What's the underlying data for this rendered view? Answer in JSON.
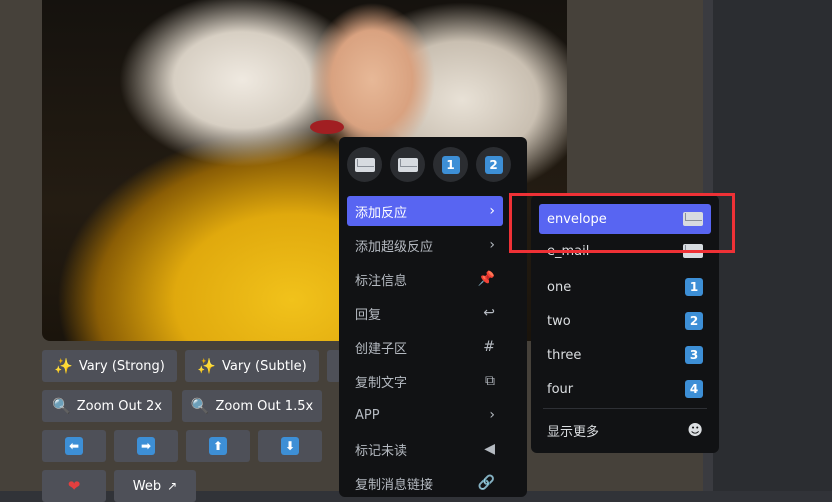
{
  "image_buttons": [
    {
      "label": "Vary (Strong)",
      "icon": "sparkles-icon"
    },
    {
      "label": "Vary (Subtle)",
      "icon": "sparkles-icon"
    },
    {
      "label": "Zoom Out 2x",
      "icon": "magnifier-icon"
    },
    {
      "label": "Zoom Out 1.5x",
      "icon": "magnifier-icon"
    },
    {
      "label": "",
      "icon": "arrow-left-icon"
    },
    {
      "label": "",
      "icon": "arrow-right-icon"
    },
    {
      "label": "",
      "icon": "arrow-up-icon"
    },
    {
      "label": "",
      "icon": "arrow-down-icon"
    },
    {
      "label": "",
      "icon": "heart-icon"
    },
    {
      "label": "Web",
      "icon": "external-link-icon"
    }
  ],
  "quick_reactions": [
    {
      "emoji": "envelope",
      "glyph": "✉"
    },
    {
      "emoji": "e_mail",
      "glyph": "✉"
    },
    {
      "emoji": "one",
      "glyph": "1"
    },
    {
      "emoji": "two",
      "glyph": "2"
    }
  ],
  "menu": {
    "items": [
      {
        "label": "添加反应",
        "right": "›"
      },
      {
        "label": "添加超级反应",
        "right": "›"
      },
      {
        "label": "标注信息",
        "right": "📌"
      },
      {
        "label": "回复",
        "right": "↩"
      },
      {
        "label": "创建子区",
        "right": "#"
      },
      {
        "label": "复制文字",
        "right": "⧉"
      },
      {
        "label": "APP",
        "right": "›"
      },
      {
        "label": "标记未读",
        "right": "◀"
      },
      {
        "label": "复制消息链接",
        "right": "🔗"
      }
    ]
  },
  "submenu": {
    "items": [
      {
        "name": "envelope",
        "glyph": "envelope"
      },
      {
        "name": "e_mail",
        "glyph": "envelope"
      },
      {
        "name": "one",
        "glyph": "1"
      },
      {
        "name": "two",
        "glyph": "2"
      },
      {
        "name": "three",
        "glyph": "3"
      },
      {
        "name": "four",
        "glyph": "4"
      }
    ],
    "show_more": "显示更多"
  },
  "colors": {
    "accent": "#5865f2",
    "highlight": "#ef3136",
    "keycap": "#3d8fd6"
  }
}
